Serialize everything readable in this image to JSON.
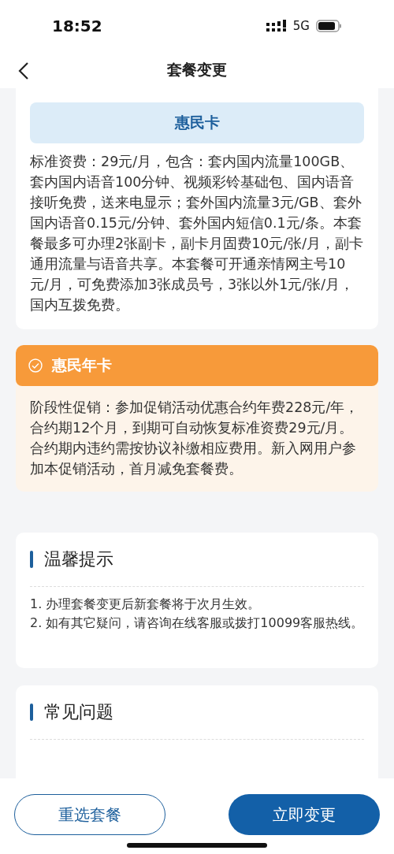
{
  "status_bar": {
    "time": "18:52",
    "network": "5G"
  },
  "nav": {
    "title": "套餐变更"
  },
  "plans": [
    {
      "name": "惠民卡",
      "selected": false,
      "description": "标准资费：29元/月，包含：套内国内流量100GB、套内国内语音100分钟、视频彩铃基础包、国内语音接听免费，送来电显示；套外国内流量3元/GB、套外国内语音0.15元/分钟、套外国内短信0.1元/条。本套餐最多可办理2张副卡，副卡月固费10元/张/月，副卡通用流量与语音共享。本套餐可开通亲情网主号10元/月，可免费添加3张成员号，3张以外1元/张/月，国内互拨免费。"
    },
    {
      "name": "惠民年卡",
      "selected": true,
      "description": "阶段性促销：参加促销活动优惠合约年费228元/年，合约期12个月，到期可自动恢复标准资费29元/月。合约期内违约需按协议补缴相应费用。新入网用户参加本促销活动，首月减免套餐费。"
    }
  ],
  "tips": {
    "title": "温馨提示",
    "lines": [
      "1. 办理套餐变更后新套餐将于次月生效。",
      "2. 如有其它疑问，请咨询在线客服或拨打10099客服热线。"
    ]
  },
  "faq": {
    "title": "常见问题"
  },
  "buttons": [
    {
      "kind": "secondary",
      "label": "重选套餐"
    },
    {
      "kind": "primary",
      "label": "立即变更"
    }
  ]
}
